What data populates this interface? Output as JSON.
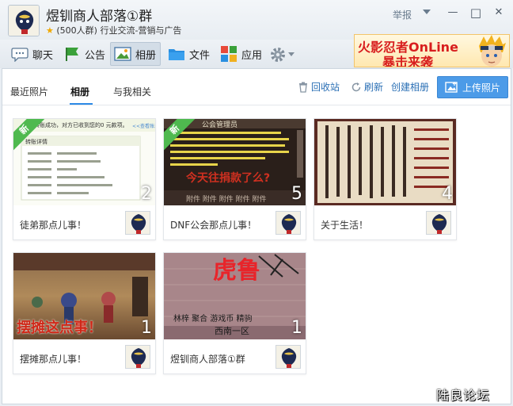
{
  "window": {
    "group_name": "煜钏商人部落①群",
    "member_count": "(500人群)",
    "category": "行业交流-营销与广告",
    "report_label": "举报",
    "minimize": "—",
    "maximize": "□",
    "close": "✕"
  },
  "toolbar": {
    "items": [
      {
        "label": "聊天",
        "icon": "chat-bubble-icon"
      },
      {
        "label": "公告",
        "icon": "flag-icon"
      },
      {
        "label": "相册",
        "icon": "photo-icon"
      },
      {
        "label": "文件",
        "icon": "folder-icon"
      },
      {
        "label": "应用",
        "icon": "apps-grid-icon"
      }
    ],
    "settings_icon": "gear-icon",
    "active": "相册"
  },
  "banner": {
    "line1": "火影忍者OnLine",
    "line2": "暴击来袭"
  },
  "subtabs": {
    "items": [
      "最近照片",
      "相册",
      "与我相关"
    ],
    "active": "相册"
  },
  "actions": {
    "recycle": "回收站",
    "refresh": "刷新",
    "create": "创建相册",
    "upload": "上传照片"
  },
  "albums": [
    {
      "name": "徒弟那点儿事！",
      "count": "2",
      "is_new": true,
      "new_label": "新"
    },
    {
      "name": "DNF公会那点儿事！",
      "count": "5",
      "is_new": true,
      "new_label": "新"
    },
    {
      "name": "关于生活！",
      "count": "4",
      "is_new": false
    },
    {
      "name": "摆摊那点儿事！",
      "count": "1",
      "is_new": false
    },
    {
      "name": "煜钏商人部落①群",
      "count": "1",
      "is_new": false
    }
  ],
  "cover_text": {
    "a1_head": "转账成功，对方已收到您的0   元款项。",
    "a1_link": "<<查看账单",
    "a1_title": "转账详情",
    "a2_header": "公会管理员",
    "a2_line": "今天往捐款了么?",
    "a2_footer": "附件  附件  附件  附件  附件",
    "a4_caption": "摆摊这点事！",
    "a5_big": "虎鲁",
    "a5_row": "林梓   聚合   游戏币   精驹",
    "a5_sub": "西南一区"
  },
  "watermark": "陆良论坛",
  "colors": {
    "accent": "#4c9be8",
    "link": "#2a6fb5",
    "new_badge": "#4fb94f",
    "banner_text": "#d81e1e"
  }
}
